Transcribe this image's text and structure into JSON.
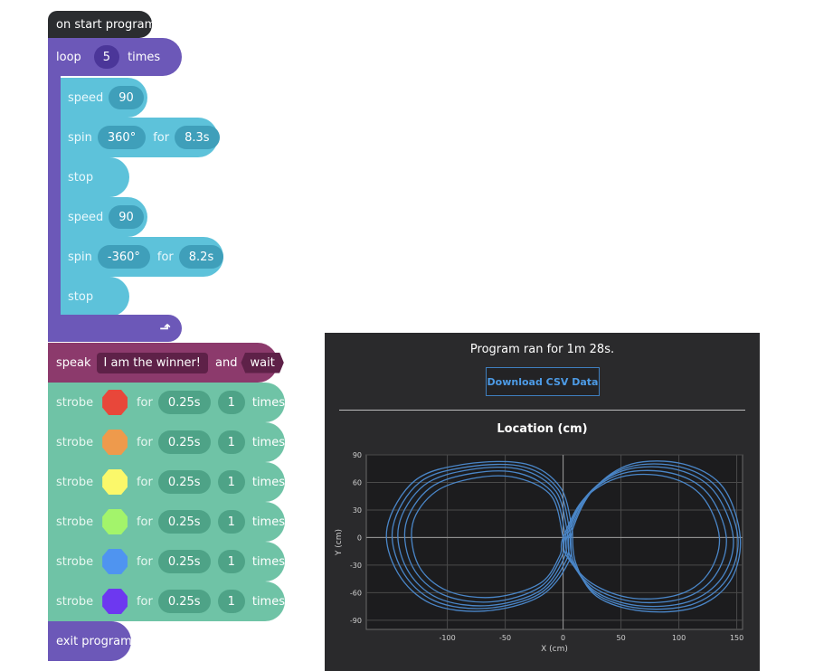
{
  "program": {
    "start_label": "on start program",
    "loop": {
      "label": "loop",
      "count": "5",
      "times": "times"
    },
    "moves": [
      {
        "kw": "speed",
        "value": "90"
      },
      {
        "kw": "spin",
        "value": "360°",
        "for_kw": "for",
        "duration": "8.3s"
      },
      {
        "kw": "stop"
      },
      {
        "kw": "speed",
        "value": "90"
      },
      {
        "kw": "spin",
        "value": "-360°",
        "for_kw": "for",
        "duration": "8.2s"
      },
      {
        "kw": "stop"
      }
    ],
    "loop_end_icon": "return-arrow-icon",
    "speak": {
      "kw": "speak",
      "text": "I am the winner!",
      "and_kw": "and",
      "wait_kw": "wait"
    },
    "strobes": [
      {
        "kw": "strobe",
        "color": "#e8473a",
        "for_kw": "for",
        "duration": "0.25s",
        "count": "1",
        "times": "times"
      },
      {
        "kw": "strobe",
        "color": "#ee9a4c",
        "for_kw": "for",
        "duration": "0.25s",
        "count": "1",
        "times": "times"
      },
      {
        "kw": "strobe",
        "color": "#fbf86a",
        "for_kw": "for",
        "duration": "0.25s",
        "count": "1",
        "times": "times"
      },
      {
        "kw": "strobe",
        "color": "#a3f46b",
        "for_kw": "for",
        "duration": "0.25s",
        "count": "1",
        "times": "times"
      },
      {
        "kw": "strobe",
        "color": "#4f94f0",
        "for_kw": "for",
        "duration": "0.25s",
        "count": "1",
        "times": "times"
      },
      {
        "kw": "strobe",
        "color": "#6d38f0",
        "for_kw": "for",
        "duration": "0.25s",
        "count": "1",
        "times": "times"
      }
    ],
    "exit_label": "exit program"
  },
  "results": {
    "ran_text": "Program ran for 1m 28s.",
    "download_label": "Download CSV Data"
  },
  "chart_data": {
    "type": "line",
    "title": "Location (cm)",
    "xlabel": "X (cm)",
    "ylabel": "Y (cm)",
    "xlim": [
      -170,
      155
    ],
    "ylim": [
      -100,
      90
    ],
    "xticks": [
      -100,
      -50,
      0,
      50,
      100,
      150
    ],
    "yticks": [
      90,
      60,
      30,
      0,
      -30,
      -60,
      -90
    ],
    "grid": true,
    "line_color": "#4a86c8",
    "series": [
      {
        "values": [
          {
            "x": 0,
            "y": 0
          },
          {
            "x": -10,
            "y": 45
          },
          {
            "x": -40,
            "y": 65
          },
          {
            "x": -75,
            "y": 65
          },
          {
            "x": -110,
            "y": 50
          },
          {
            "x": -130,
            "y": 15
          },
          {
            "x": -125,
            "y": -30
          },
          {
            "x": -100,
            "y": -58
          },
          {
            "x": -60,
            "y": -65
          },
          {
            "x": -20,
            "y": -50
          },
          {
            "x": -3,
            "y": -20
          },
          {
            "x": 0,
            "y": 0
          },
          {
            "x": 18,
            "y": 42
          },
          {
            "x": 50,
            "y": 66
          },
          {
            "x": 90,
            "y": 66
          },
          {
            "x": 120,
            "y": 45
          },
          {
            "x": 135,
            "y": 0
          },
          {
            "x": 125,
            "y": -40
          },
          {
            "x": 100,
            "y": -62
          },
          {
            "x": 60,
            "y": -66
          },
          {
            "x": 25,
            "y": -50
          },
          {
            "x": 3,
            "y": -20
          },
          {
            "x": 0,
            "y": 0
          }
        ]
      },
      {
        "values": [
          {
            "x": 2,
            "y": 2
          },
          {
            "x": -8,
            "y": 47
          },
          {
            "x": -38,
            "y": 70
          },
          {
            "x": -78,
            "y": 70
          },
          {
            "x": -115,
            "y": 54
          },
          {
            "x": -136,
            "y": 14
          },
          {
            "x": -130,
            "y": -32
          },
          {
            "x": -104,
            "y": -62
          },
          {
            "x": -62,
            "y": -70
          },
          {
            "x": -20,
            "y": -54
          },
          {
            "x": -1,
            "y": -20
          },
          {
            "x": 2,
            "y": 2
          },
          {
            "x": 20,
            "y": 45
          },
          {
            "x": 52,
            "y": 70
          },
          {
            "x": 94,
            "y": 70
          },
          {
            "x": 125,
            "y": 48
          },
          {
            "x": 141,
            "y": 0
          },
          {
            "x": 131,
            "y": -42
          },
          {
            "x": 104,
            "y": -66
          },
          {
            "x": 62,
            "y": -70
          },
          {
            "x": 26,
            "y": -54
          },
          {
            "x": 5,
            "y": -22
          },
          {
            "x": 2,
            "y": 2
          }
        ]
      },
      {
        "values": [
          {
            "x": 4,
            "y": 4
          },
          {
            "x": -6,
            "y": 50
          },
          {
            "x": -36,
            "y": 74
          },
          {
            "x": -80,
            "y": 74
          },
          {
            "x": -120,
            "y": 57
          },
          {
            "x": -142,
            "y": 13
          },
          {
            "x": -135,
            "y": -34
          },
          {
            "x": -108,
            "y": -66
          },
          {
            "x": -64,
            "y": -74
          },
          {
            "x": -20,
            "y": -58
          },
          {
            "x": 1,
            "y": -22
          },
          {
            "x": 4,
            "y": 4
          },
          {
            "x": 22,
            "y": 48
          },
          {
            "x": 55,
            "y": 74
          },
          {
            "x": 98,
            "y": 74
          },
          {
            "x": 130,
            "y": 51
          },
          {
            "x": 147,
            "y": 0
          },
          {
            "x": 137,
            "y": -44
          },
          {
            "x": 108,
            "y": -70
          },
          {
            "x": 64,
            "y": -74
          },
          {
            "x": 27,
            "y": -58
          },
          {
            "x": 7,
            "y": -24
          },
          {
            "x": 4,
            "y": 4
          }
        ]
      },
      {
        "values": [
          {
            "x": 6,
            "y": 6
          },
          {
            "x": -4,
            "y": 52
          },
          {
            "x": -34,
            "y": 77
          },
          {
            "x": -82,
            "y": 77
          },
          {
            "x": -124,
            "y": 60
          },
          {
            "x": -147,
            "y": 12
          },
          {
            "x": -139,
            "y": -36
          },
          {
            "x": -111,
            "y": -69
          },
          {
            "x": -66,
            "y": -77
          },
          {
            "x": -20,
            "y": -61
          },
          {
            "x": 3,
            "y": -24
          },
          {
            "x": 6,
            "y": 6
          },
          {
            "x": 24,
            "y": 50
          },
          {
            "x": 57,
            "y": 77
          },
          {
            "x": 101,
            "y": 77
          },
          {
            "x": 134,
            "y": 53
          },
          {
            "x": 151,
            "y": 0
          },
          {
            "x": 141,
            "y": -46
          },
          {
            "x": 111,
            "y": -73
          },
          {
            "x": 66,
            "y": -77
          },
          {
            "x": 28,
            "y": -61
          },
          {
            "x": 9,
            "y": -26
          },
          {
            "x": 6,
            "y": 6
          }
        ]
      },
      {
        "values": [
          {
            "x": 8,
            "y": 8
          },
          {
            "x": -2,
            "y": 54
          },
          {
            "x": -32,
            "y": 80
          },
          {
            "x": -84,
            "y": 80
          },
          {
            "x": -128,
            "y": 62
          },
          {
            "x": -152,
            "y": 11
          },
          {
            "x": -143,
            "y": -38
          },
          {
            "x": -114,
            "y": -72
          },
          {
            "x": -68,
            "y": -80
          },
          {
            "x": -20,
            "y": -64
          },
          {
            "x": 5,
            "y": -26
          },
          {
            "x": 8,
            "y": 8
          },
          {
            "x": 26,
            "y": 52
          },
          {
            "x": 59,
            "y": 80
          },
          {
            "x": 104,
            "y": 80
          },
          {
            "x": 138,
            "y": 55
          },
          {
            "x": 153,
            "y": 0
          },
          {
            "x": 144,
            "y": -48
          },
          {
            "x": 114,
            "y": -76
          },
          {
            "x": 68,
            "y": -80
          },
          {
            "x": 29,
            "y": -64
          },
          {
            "x": 11,
            "y": -28
          },
          {
            "x": 8,
            "y": 8
          }
        ]
      }
    ]
  }
}
